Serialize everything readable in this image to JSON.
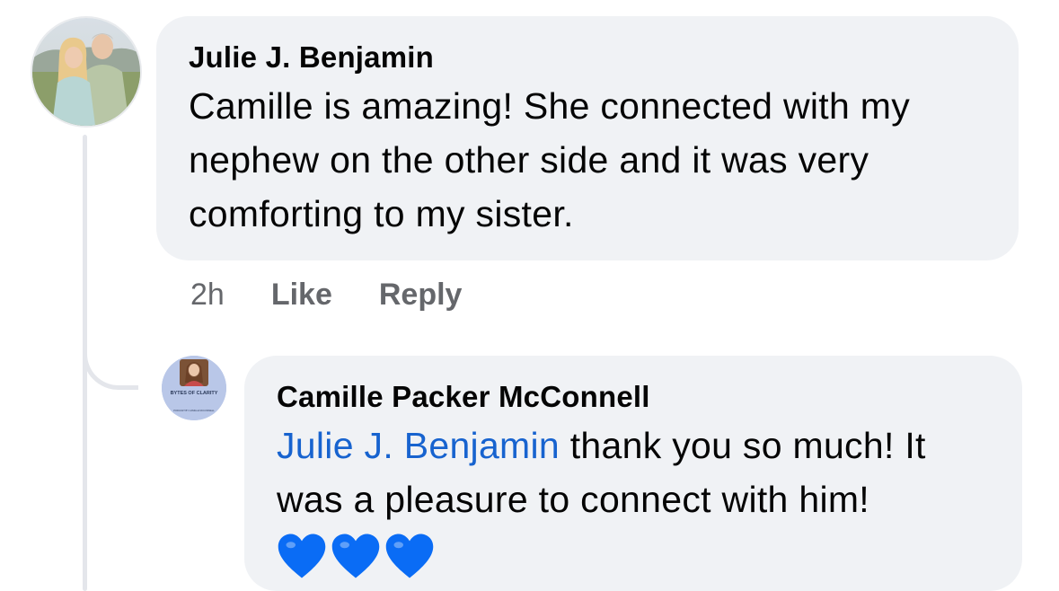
{
  "main_comment": {
    "author": "Julie J. Benjamin",
    "text": "Camille is amazing! She connected with my nephew on the other side and it was very comforting to my sister.",
    "time": "2h",
    "like_label": "Like",
    "reply_label": "Reply"
  },
  "reply_comment": {
    "author": "Camille Packer McConnell",
    "mention": "Julie J. Benjamin",
    "text": " thank you so much! It was a pleasure to connect with him!",
    "avatar_title": "BYTES OF CLARITY",
    "avatar_subtitle": "PODCAST BY CAMILLE MCCONNELL",
    "heart_count": 3
  },
  "colors": {
    "bubble": "#f0f2f5",
    "mention": "#1763cf",
    "meta": "#65676b",
    "heart": "#0a6cf5"
  },
  "icons": {
    "heart": "blue-heart-icon"
  }
}
